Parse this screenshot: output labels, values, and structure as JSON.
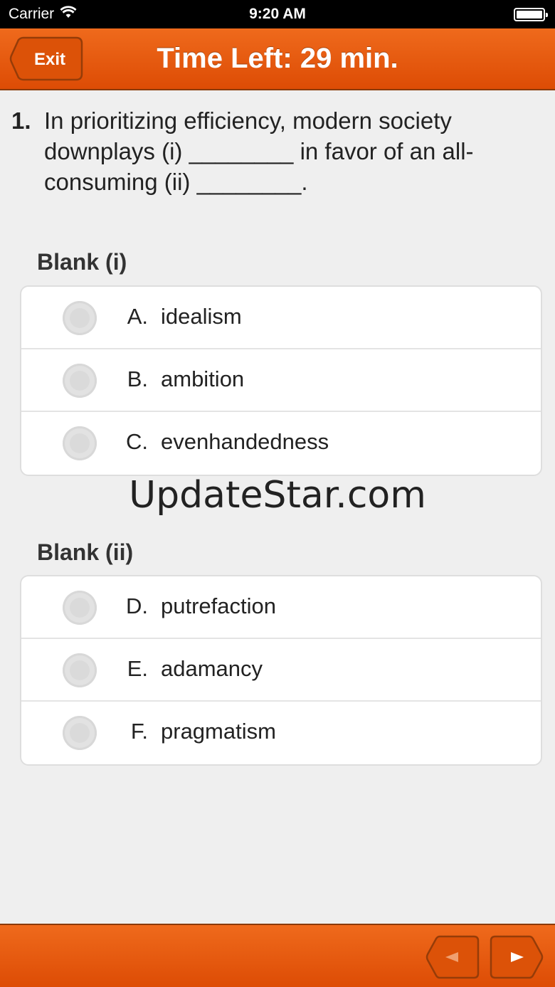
{
  "status_bar": {
    "carrier": "Carrier",
    "time": "9:20 AM"
  },
  "header": {
    "exit_label": "Exit",
    "title": "Time Left: 29 min."
  },
  "question": {
    "number": "1.",
    "text": "In prioritizing efficiency, modern society downplays (i) ________ in favor of an all-consuming (ii) ________."
  },
  "blank_i": {
    "label": "Blank (i)",
    "options": [
      {
        "letter": "A.",
        "text": "idealism"
      },
      {
        "letter": "B.",
        "text": "ambition"
      },
      {
        "letter": "C.",
        "text": "evenhandedness"
      }
    ]
  },
  "watermark": "UpdateStar.com",
  "blank_ii": {
    "label": "Blank (ii)",
    "options": [
      {
        "letter": "D.",
        "text": "putrefaction"
      },
      {
        "letter": "E.",
        "text": "adamancy"
      },
      {
        "letter": "F.",
        "text": "pragmatism"
      }
    ]
  },
  "footer": {
    "prev_icon": "left-arrow-icon",
    "next_icon": "right-arrow-icon"
  },
  "colors": {
    "accent": "#e65a10",
    "background": "#efefef"
  }
}
